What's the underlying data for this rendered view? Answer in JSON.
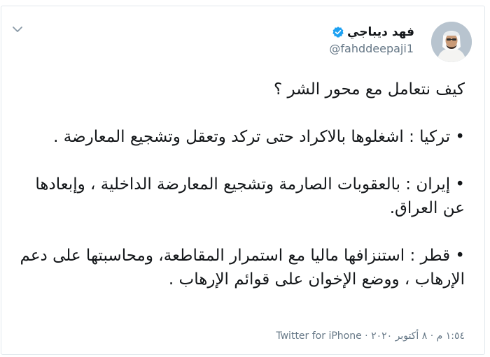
{
  "author": {
    "name": "فهد ديباجي",
    "handle": "@fahddeepaji1",
    "verified": true
  },
  "tweet": {
    "title": "كيف نتعامل مع محور الشر ؟",
    "paragraphs": [
      "• تركيا : اشغلوها  بالاكراد حتى تركد وتعقل وتشجيع المعارضة .",
      "• إيران : بالعقوبات الصارمة وتشجيع المعارضة الداخلية ، وإبعادها عن العراق.",
      "• قطر : استنزافها ماليا مع استمرار المقاطعة، ومحاسبتها على دعم الإرهاب ، ووضع الإخوان على قوائم الإرهاب ."
    ]
  },
  "meta": {
    "time": "١:٥٤ م",
    "date": "٨ أكتوبر ٢٠٢٠",
    "separator": "·",
    "source": "Twitter for iPhone"
  },
  "icons": {
    "menu": "chevron-down-icon",
    "verified": "verified-badge-icon",
    "avatar": "avatar-photo"
  },
  "colors": {
    "text": "#14171a",
    "secondary": "#657786",
    "verified": "#1da1f2",
    "border": "#e1e8ed"
  }
}
